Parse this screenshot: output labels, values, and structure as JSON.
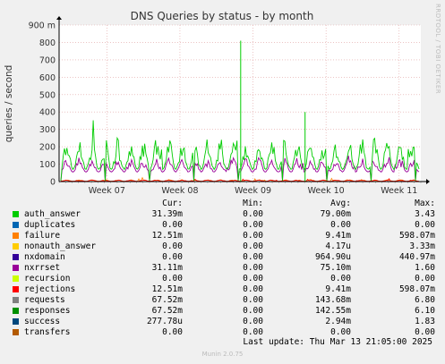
{
  "chart_data": {
    "type": "line",
    "title": "DNS Queries by status - by month",
    "ylabel": "queries / second",
    "ylim": [
      0,
      900
    ],
    "yticks": [
      "0",
      "100",
      "200",
      "300",
      "400",
      "500",
      "600",
      "700",
      "800",
      "900 m"
    ],
    "xticks": [
      "Week 07",
      "Week 08",
      "Week 09",
      "Week 10",
      "Week 11"
    ],
    "grid": true,
    "series": [
      {
        "name": "auth_answer",
        "color": "#00cc00"
      },
      {
        "name": "duplicates",
        "color": "#0066b3"
      },
      {
        "name": "failure",
        "color": "#ff8000"
      },
      {
        "name": "nonauth_answer",
        "color": "#ffcc00"
      },
      {
        "name": "nxdomain",
        "color": "#330099"
      },
      {
        "name": "nxrrset",
        "color": "#990099"
      },
      {
        "name": "recursion",
        "color": "#ccff00"
      },
      {
        "name": "rejections",
        "color": "#ff0000"
      },
      {
        "name": "requests",
        "color": "#808080"
      },
      {
        "name": "responses",
        "color": "#008f00"
      },
      {
        "name": "success",
        "color": "#00487d"
      },
      {
        "name": "transfers",
        "color": "#b35a00"
      }
    ]
  },
  "legend": {
    "headers": {
      "cur": "Cur:",
      "min": "Min:",
      "avg": "Avg:",
      "max": "Max:"
    },
    "rows": [
      {
        "name": "auth_answer",
        "cur": "31.39m",
        "min": "0.00",
        "avg": "79.00m",
        "max": "3.43"
      },
      {
        "name": "duplicates",
        "cur": "0.00",
        "min": "0.00",
        "avg": "0.00",
        "max": "0.00"
      },
      {
        "name": "failure",
        "cur": "12.51m",
        "min": "0.00",
        "avg": "9.41m",
        "max": "598.07m"
      },
      {
        "name": "nonauth_answer",
        "cur": "0.00",
        "min": "0.00",
        "avg": "4.17u",
        "max": "3.33m"
      },
      {
        "name": "nxdomain",
        "cur": "0.00",
        "min": "0.00",
        "avg": "964.90u",
        "max": "440.97m"
      },
      {
        "name": "nxrrset",
        "cur": "31.11m",
        "min": "0.00",
        "avg": "75.10m",
        "max": "1.60"
      },
      {
        "name": "recursion",
        "cur": "0.00",
        "min": "0.00",
        "avg": "0.00",
        "max": "0.00"
      },
      {
        "name": "rejections",
        "cur": "12.51m",
        "min": "0.00",
        "avg": "9.41m",
        "max": "598.07m"
      },
      {
        "name": "requests",
        "cur": "67.52m",
        "min": "0.00",
        "avg": "143.68m",
        "max": "6.80"
      },
      {
        "name": "responses",
        "cur": "67.52m",
        "min": "0.00",
        "avg": "142.55m",
        "max": "6.10"
      },
      {
        "name": "success",
        "cur": "277.78u",
        "min": "0.00",
        "avg": "2.94m",
        "max": "1.83"
      },
      {
        "name": "transfers",
        "cur": "0.00",
        "min": "0.00",
        "avg": "0.00",
        "max": "0.00"
      }
    ]
  },
  "footer": {
    "last_update": "Last update: Thu Mar 13 21:05:00 2025",
    "munin_version": "Munin 2.0.75",
    "rrdtool": "RRDTOOL / TOBI OETIKER"
  }
}
